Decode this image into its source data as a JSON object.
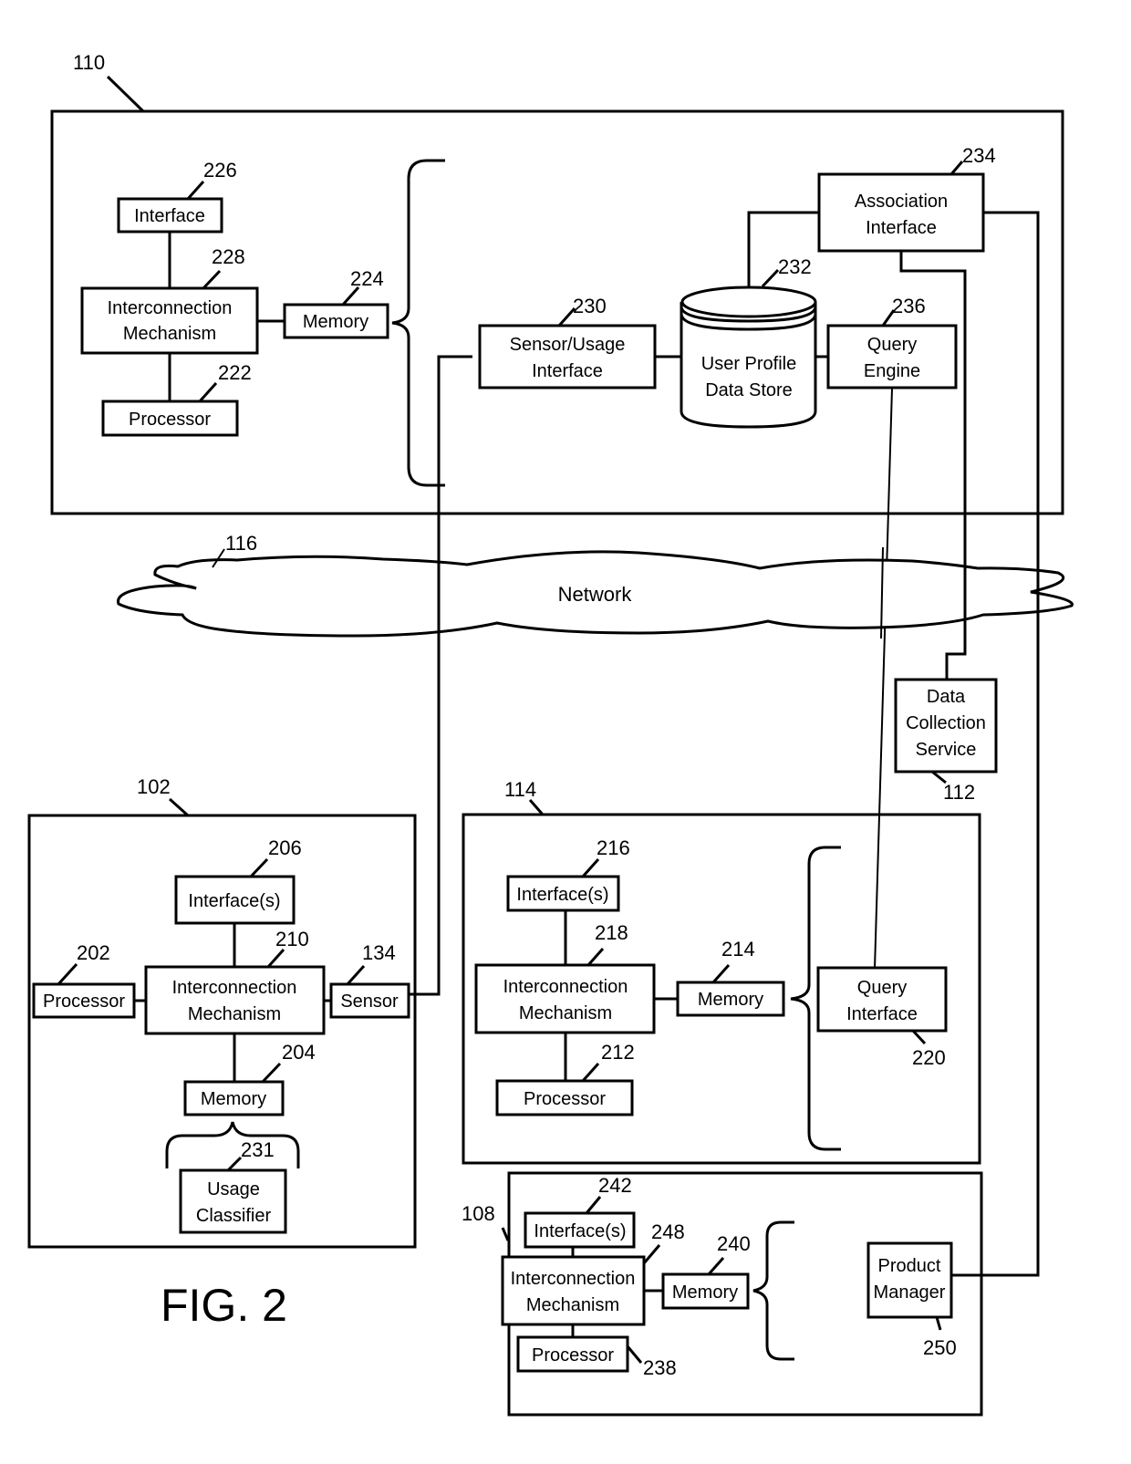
{
  "figure": {
    "caption": "FIG. 2"
  },
  "network": {
    "ref": "116",
    "label": "Network"
  },
  "server_110": {
    "ref": "110",
    "interface": {
      "label": "Interface",
      "ref": "226"
    },
    "interconnect": {
      "label_line1": "Interconnection",
      "label_line2": "Mechanism",
      "ref": "228"
    },
    "memory": {
      "label": "Memory",
      "ref": "224"
    },
    "processor": {
      "label": "Processor",
      "ref": "222"
    },
    "sensor_usage_interface": {
      "label_line1": "Sensor/Usage",
      "label_line2": "Interface",
      "ref": "230"
    },
    "user_profile_store": {
      "label_line1": "User Profile",
      "label_line2": "Data Store",
      "ref": "232"
    },
    "association_interface": {
      "label_line1": "Association",
      "label_line2": "Interface",
      "ref": "234"
    },
    "query_engine": {
      "label_line1": "Query",
      "label_line2": "Engine",
      "ref": "236"
    }
  },
  "data_collection_service": {
    "label_line1": "Data",
    "label_line2": "Collection",
    "label_line3": "Service",
    "ref": "112"
  },
  "device_102": {
    "ref": "102",
    "interfaces": {
      "label": "Interface(s)",
      "ref": "206"
    },
    "interconnect": {
      "label_line1": "Interconnection",
      "label_line2": "Mechanism",
      "ref": "210"
    },
    "processor": {
      "label": "Processor",
      "ref": "202"
    },
    "sensor": {
      "label": "Sensor",
      "ref": "134"
    },
    "memory": {
      "label": "Memory",
      "ref": "204"
    },
    "usage_classifier": {
      "label_line1": "Usage",
      "label_line2": "Classifier",
      "ref": "231"
    }
  },
  "device_114": {
    "ref": "114",
    "interfaces": {
      "label": "Interface(s)",
      "ref": "216"
    },
    "interconnect": {
      "label_line1": "Interconnection",
      "label_line2": "Mechanism",
      "ref": "218"
    },
    "memory": {
      "label": "Memory",
      "ref": "214"
    },
    "processor": {
      "label": "Processor",
      "ref": "212"
    },
    "query_interface": {
      "label_line1": "Query",
      "label_line2": "Interface",
      "ref": "220"
    }
  },
  "device_108": {
    "ref": "108",
    "interfaces": {
      "label": "Interface(s)",
      "ref": "242"
    },
    "interconnect": {
      "label_line1": "Interconnection",
      "label_line2": "Mechanism",
      "ref": "248"
    },
    "memory": {
      "label": "Memory",
      "ref": "240"
    },
    "processor": {
      "label": "Processor",
      "ref": "238"
    },
    "product_manager": {
      "label_line1": "Product",
      "label_line2": "Manager",
      "ref": "250"
    }
  }
}
